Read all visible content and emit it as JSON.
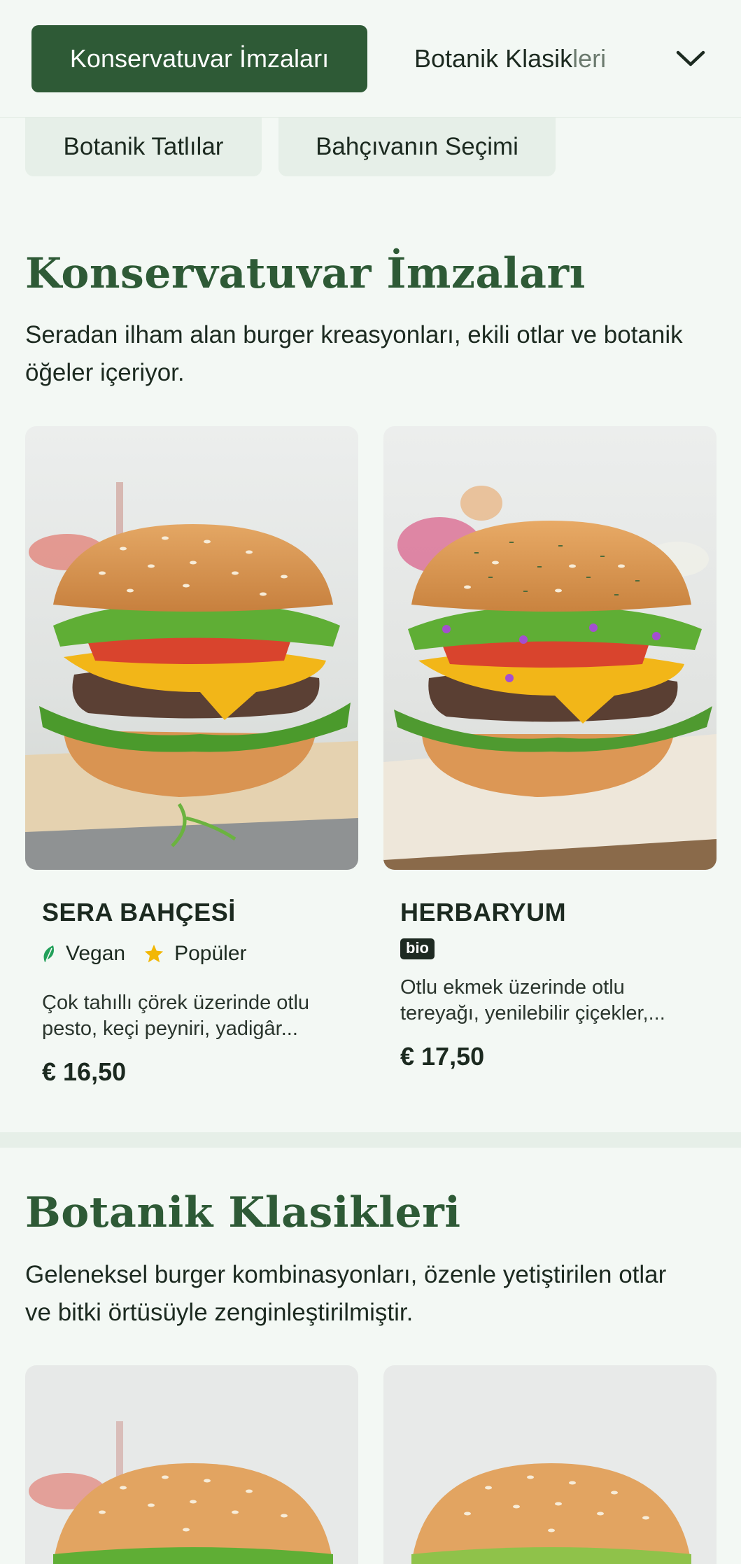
{
  "nav": {
    "active_tab": "Konservatuvar İmzaları",
    "next_tab_main": "Botanik Klasik",
    "next_tab_fade": "leri",
    "chips": [
      "Botanik Tatlılar",
      "Bahçıvanın Seçimi"
    ]
  },
  "sections": [
    {
      "title": "Konservatuvar İmzaları",
      "description": "Seradan ilham alan burger kreasyonları, ekili otlar ve botanik öğeler içeriyor.",
      "items": [
        {
          "name": "SERA BAHÇESİ",
          "tags": [
            {
              "icon": "leaf-icon",
              "label": "Vegan",
              "color": "#22a05a"
            },
            {
              "icon": "star-icon",
              "label": "Popüler",
              "color": "#f2b705"
            }
          ],
          "description": "Çok tahıllı çörek üzerinde otlu pesto, keçi peyniri, yadigâr...",
          "price": "€ 16,50"
        },
        {
          "name": "HERBARYUM",
          "badge": "bio",
          "description": "Otlu ekmek üzerinde otlu tereyağı, yenilebilir çiçekler,...",
          "price": "€ 17,50"
        }
      ]
    },
    {
      "title": "Botanik Klasikleri",
      "description": "Geleneksel burger kombinasyonları, özenle yetiştirilen otlar ve bitki örtüsüyle zenginleştirilmiştir."
    }
  ],
  "colors": {
    "accent": "#2e5a36",
    "background": "#f3f8f4",
    "chip_bg": "#e6efe8"
  }
}
